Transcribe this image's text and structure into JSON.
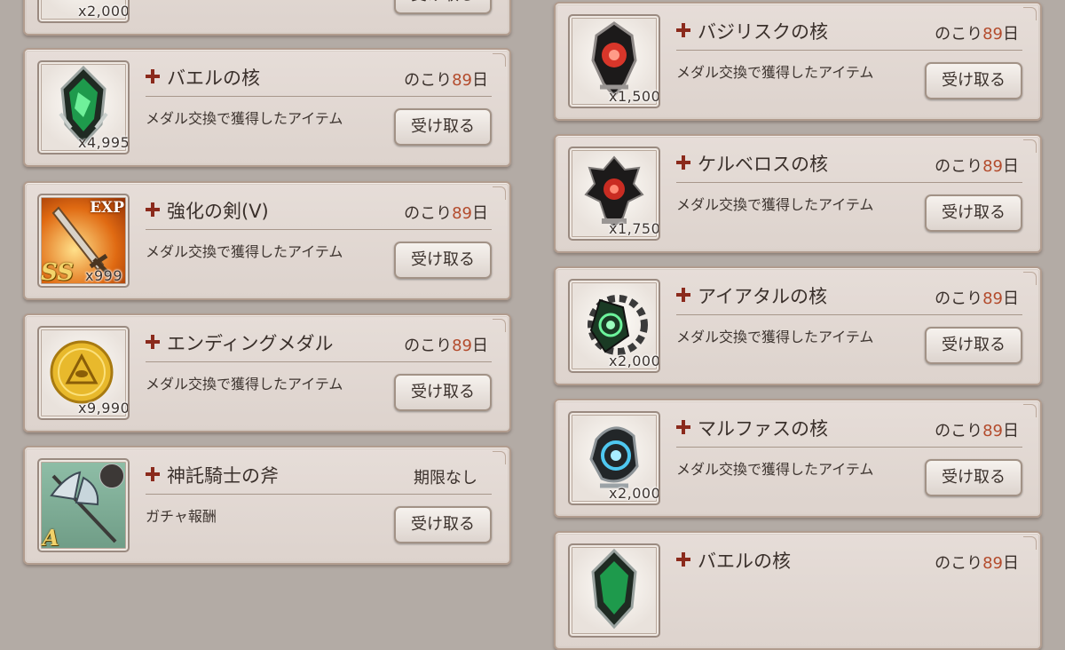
{
  "action_label": "受け取る",
  "remaining_prefix": "のこり",
  "remaining_suffix": "日",
  "colors": {
    "remaining_number": "#b34b2c",
    "cross": "#8b2a1c",
    "card_bg": "#e2d9d3"
  },
  "left_column": [
    {
      "name": "",
      "remaining_days": "",
      "expiry_text": "",
      "description": "",
      "quantity": "x2,000",
      "icon": "gem-icon-partial"
    },
    {
      "name": "バエルの核",
      "remaining_days": "89",
      "expiry_text": "",
      "description": "メダル交換で獲得したアイテム",
      "quantity": "x4,995",
      "icon": "green-core-icon"
    },
    {
      "name": "強化の剣(V)",
      "remaining_days": "89",
      "expiry_text": "",
      "description": "メダル交換で獲得したアイテム",
      "quantity": "x999",
      "icon": "exp-sword-icon",
      "badge_exp": "EXP",
      "badge_rank": "SS"
    },
    {
      "name": "エンディングメダル",
      "remaining_days": "89",
      "expiry_text": "",
      "description": "メダル交換で獲得したアイテム",
      "quantity": "x9,990",
      "icon": "gold-medal-icon"
    },
    {
      "name": "神託騎士の斧",
      "remaining_days": "",
      "expiry_text": "期限なし",
      "description": "ガチャ報酬",
      "quantity": "",
      "icon": "axe-icon",
      "badge_rank": "A"
    }
  ],
  "right_column": [
    {
      "name": "バジリスクの核",
      "remaining_days": "89",
      "expiry_text": "",
      "description": "メダル交換で獲得したアイテム",
      "quantity": "x1,500",
      "icon": "red-core-icon"
    },
    {
      "name": "ケルベロスの核",
      "remaining_days": "89",
      "expiry_text": "",
      "description": "メダル交換で獲得したアイテム",
      "quantity": "x1,750",
      "icon": "red-core-icon"
    },
    {
      "name": "アイアタルの核",
      "remaining_days": "89",
      "expiry_text": "",
      "description": "メダル交換で獲得したアイテム",
      "quantity": "x2,000",
      "icon": "green-gear-core-icon"
    },
    {
      "name": "マルファスの核",
      "remaining_days": "89",
      "expiry_text": "",
      "description": "メダル交換で獲得したアイテム",
      "quantity": "x2,000",
      "icon": "blue-core-icon"
    },
    {
      "name": "バエルの核",
      "remaining_days": "89",
      "expiry_text": "",
      "description": "",
      "quantity": "",
      "icon": "green-core-icon"
    }
  ]
}
